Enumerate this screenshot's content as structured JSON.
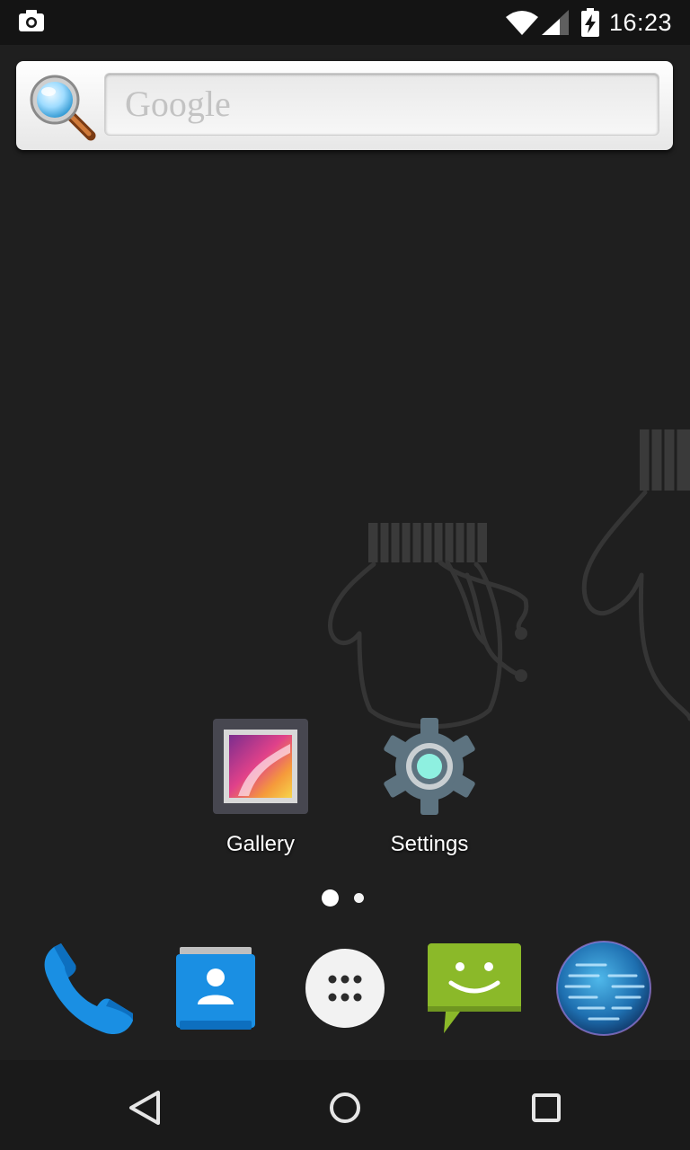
{
  "status_bar": {
    "time": "16:23",
    "icons": [
      "camera-icon",
      "wifi-icon",
      "cell-signal-icon",
      "battery-charging-icon"
    ]
  },
  "search_widget": {
    "placeholder": "Google",
    "icon": "magnifier-icon"
  },
  "home_apps": [
    {
      "label": "Gallery",
      "icon": "gallery-icon"
    },
    {
      "label": "Settings",
      "icon": "settings-icon"
    }
  ],
  "page_indicator": {
    "pages": 2,
    "current": 1
  },
  "dock": {
    "items": [
      "phone-icon",
      "contacts-icon",
      "app-drawer-icon",
      "messaging-icon",
      "browser-icon"
    ]
  },
  "nav_bar": {
    "buttons": [
      "back-icon",
      "home-icon",
      "recents-icon"
    ]
  },
  "colors": {
    "background": "#1f1f1f",
    "accent_blue": "#1e88e5",
    "messaging_green": "#8bb929",
    "settings_teal": "#8ef0e0"
  }
}
